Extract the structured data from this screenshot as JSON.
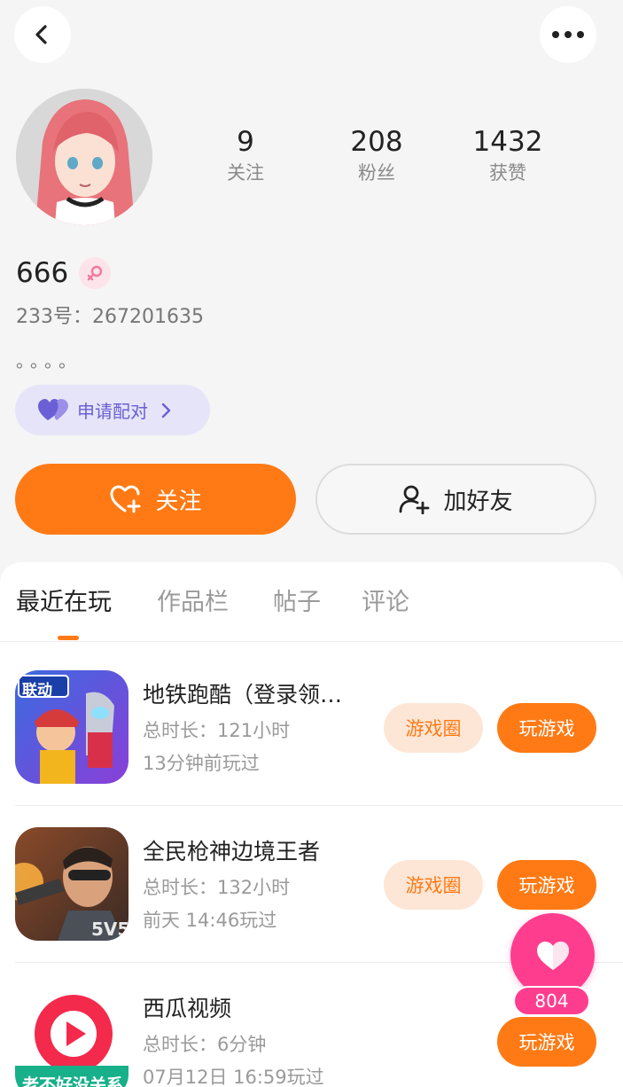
{
  "header": {
    "back_icon": "chevron-left-icon",
    "more_icon": "more-horizontal-icon"
  },
  "profile": {
    "stats": [
      {
        "value": "9",
        "label": "关注"
      },
      {
        "value": "208",
        "label": "粉丝"
      },
      {
        "value": "1432",
        "label": "获赞"
      }
    ],
    "username": "666",
    "gender_icon": "female-symbol-icon",
    "id_line": "233号：267201635",
    "bio": "。。。。",
    "pair_button": {
      "label": "申请配对",
      "icon": "heart-pair-icon"
    }
  },
  "actions": {
    "follow_label": "关注",
    "add_friend_label": "加好友"
  },
  "tabs": [
    {
      "label": "最近在玩",
      "active": true
    },
    {
      "label": "作品栏",
      "active": false
    },
    {
      "label": "帖子",
      "active": false
    },
    {
      "label": "评论",
      "active": false
    }
  ],
  "games": [
    {
      "title": "地铁跑酷（登录领…",
      "duration": "总时长：121小时",
      "last_played": "13分钟前玩过",
      "circle_label": "游戏圈",
      "play_label": "玩游戏",
      "icon_text": "联动"
    },
    {
      "title": "全民枪神边境王者",
      "duration": "总时长：132小时",
      "last_played": "前天 14:46玩过",
      "circle_label": "游戏圈",
      "play_label": "玩游戏",
      "icon_text": "5V5"
    },
    {
      "title": "西瓜视频",
      "duration": "总时长：6分钟",
      "last_played": "07月12日 16:59玩过",
      "play_label": "玩游戏",
      "icon_text": "老不好没关系"
    }
  ],
  "like_fab": {
    "count": "804"
  },
  "colors": {
    "accent": "#ff7a14",
    "pair": "#6a5fd4",
    "like": "#ff3d8f"
  }
}
